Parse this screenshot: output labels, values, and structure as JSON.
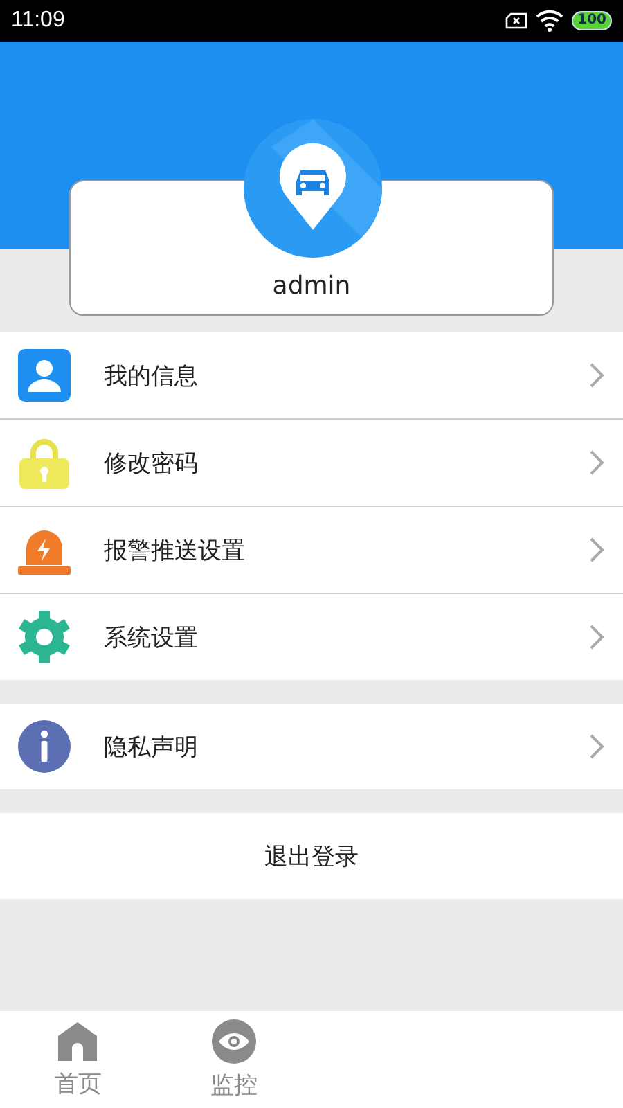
{
  "status_bar": {
    "time": "11:09",
    "battery": "100"
  },
  "profile": {
    "username": "admin"
  },
  "menu_groups": [
    {
      "items": [
        {
          "label": "我的信息",
          "kind": "person"
        },
        {
          "label": "修改密码",
          "kind": "lock"
        },
        {
          "label": "报警推送设置",
          "kind": "alarm"
        },
        {
          "label": "系统设置",
          "kind": "gear"
        }
      ]
    },
    {
      "items": [
        {
          "label": "隐私声明",
          "kind": "info"
        }
      ]
    }
  ],
  "logout_button": {
    "label": "退出登录"
  },
  "bottom_nav": [
    {
      "label": "首页",
      "kind": "home",
      "selected": false
    },
    {
      "label": "监控",
      "kind": "eye",
      "selected": false
    }
  ]
}
